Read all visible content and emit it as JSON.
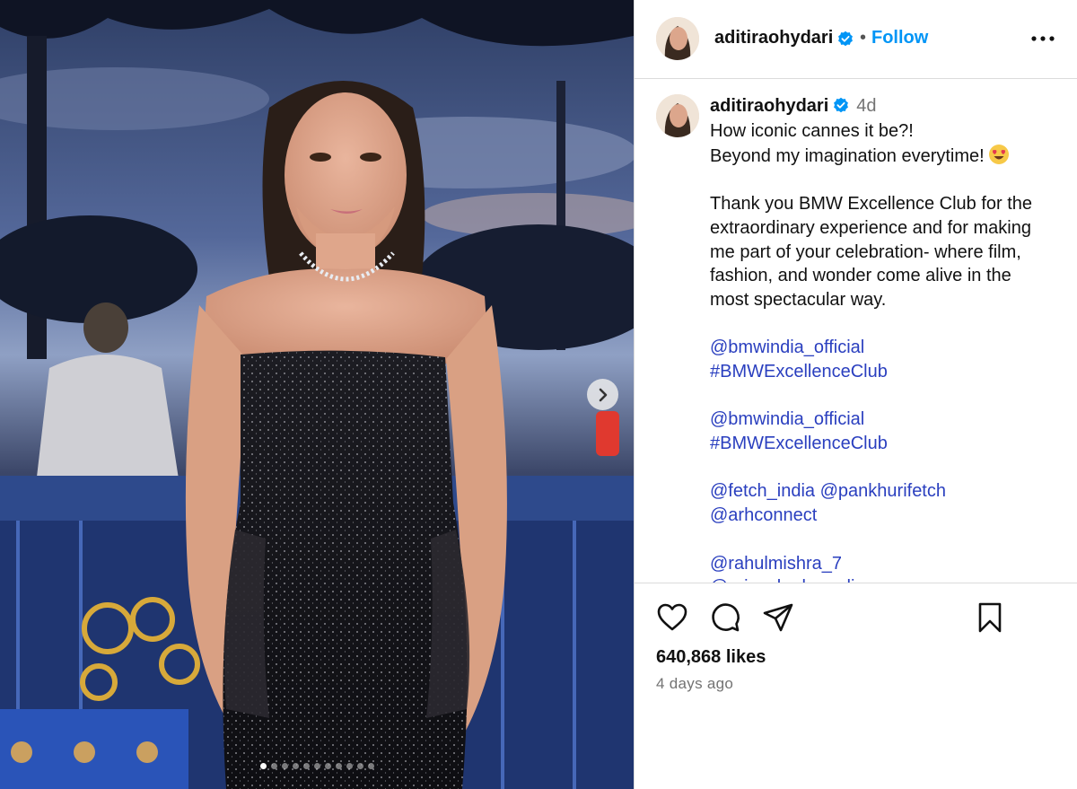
{
  "post": {
    "username": "aditirao­hydari",
    "verified_icon": "verified-badge-icon",
    "separator": "•",
    "follow_label": "Follow",
    "more_icon": "more-options-icon",
    "time_short": "4d",
    "caption_lines": [
      "How iconic cannes it be?!",
      "Beyond my imagination everytime!",
      "",
      "Thank you BMW Excellence Club for the",
      "extraordinary experience and for making",
      "me part of your celebration- where film,",
      "fashion, and wonder come alive in the",
      "most spectacular way.",
      "",
      "@bmwindia_official",
      "#BMWExcellenceClub",
      "",
      "@bmwindia_official",
      "#BMWExcellenceClub",
      "",
      "@fetch_india @pankhurifetch",
      "@arhconnect",
      "",
      "@rahulmishra_7",
      "@priyankarkapadia"
    ],
    "link_lines": [
      9,
      10,
      12,
      13,
      15,
      16,
      18,
      19
    ],
    "emoji_icon": "heart-eyes-emoji-icon",
    "likes": "640,868 likes",
    "time_long": "4 days ago",
    "carousel": {
      "total": 11,
      "active": 1
    },
    "colors": {
      "accent": "#0095f6",
      "link": "#2a3fbf",
      "muted": "#737373",
      "border": "#dbdbdb"
    }
  }
}
